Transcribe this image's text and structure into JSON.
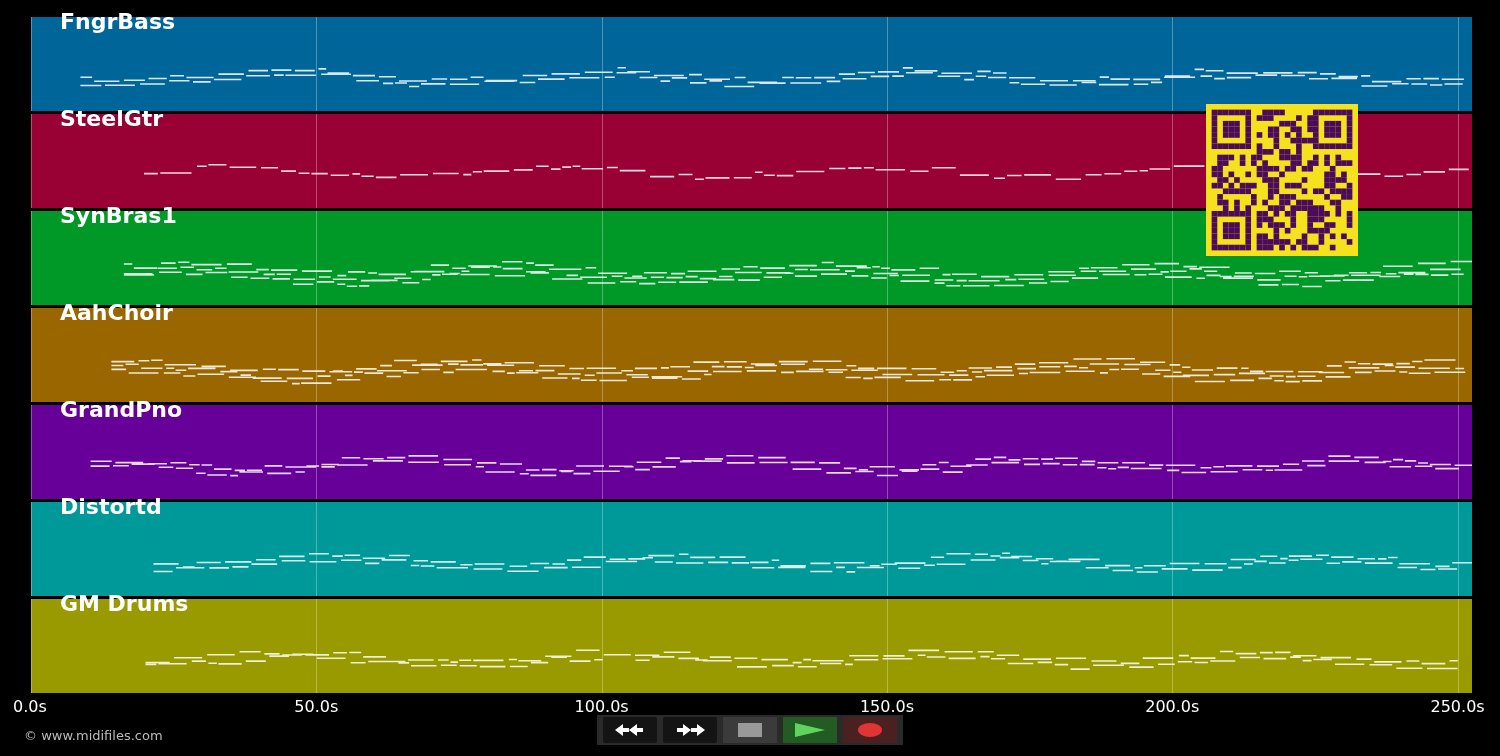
{
  "tracks": [
    {
      "name": "FngrBass",
      "color": "#006699"
    },
    {
      "name": "SteelGtr",
      "color": "#990033"
    },
    {
      "name": "SynBras1",
      "color": "#009928"
    },
    {
      "name": "AahChoir",
      "color": "#996600"
    },
    {
      "name": "GrandPno",
      "color": "#660099"
    },
    {
      "name": "Distortd",
      "color": "#009999"
    },
    {
      "name": "GM Drums",
      "color": "#999900"
    }
  ],
  "overlay": {
    "kind": "qr_code"
  },
  "time_axis": {
    "ticks": [
      "0.0s",
      "50.0s",
      "100.0s",
      "150.0s",
      "200.0s",
      "250.0s"
    ]
  },
  "controls": [
    {
      "kind": "rewind"
    },
    {
      "kind": "forward"
    },
    {
      "kind": "stop"
    },
    {
      "kind": "play"
    },
    {
      "kind": "record"
    }
  ],
  "footer": "© www.midifiles.com"
}
